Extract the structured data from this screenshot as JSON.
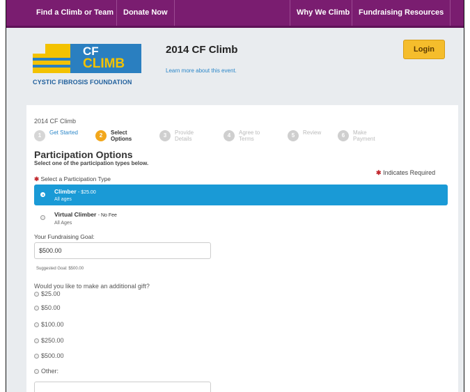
{
  "nav": {
    "items": [
      "Find a Climb or Team",
      "Donate Now",
      "Why We Climb",
      "Fundraising Resources"
    ]
  },
  "header": {
    "logo": {
      "line1": "CF",
      "line2": "CLIMB",
      "org": "CYSTIC FIBROSIS FOUNDATION"
    },
    "event_title": "2014 CF Climb",
    "event_link": "Learn more about this event.",
    "login_label": "Login"
  },
  "progress": {
    "crumb": "2014 CF Climb",
    "steps": [
      {
        "num": "1",
        "label": "Get Started",
        "state": "done"
      },
      {
        "num": "2",
        "label": "Select Options",
        "state": "active"
      },
      {
        "num": "3",
        "label": "Provide Details",
        "state": "upcoming"
      },
      {
        "num": "4",
        "label": "Agree to Terms",
        "state": "upcoming"
      },
      {
        "num": "5",
        "label": "Review",
        "state": "upcoming"
      },
      {
        "num": "6",
        "label": "Make Payment",
        "state": "upcoming"
      }
    ]
  },
  "form": {
    "heading": "Participation Options",
    "subheading": "Select one of the participation types below.",
    "required_note": "Indicates Required",
    "type_label": "Select a Participation Type",
    "options": [
      {
        "title": "Climber",
        "fee": "- $25.00",
        "sub": "All ages",
        "selected": true
      },
      {
        "title": "Virtual Climber",
        "fee": "- No Fee",
        "sub": "All Ages",
        "selected": false
      }
    ],
    "goal_label": "Your Fundraising Goal:",
    "goal_value": "$500.00",
    "goal_hint": "Suggested Goal: $500.00",
    "gift_question": "Would you like to make an additional gift?",
    "gift_options": [
      "$25.00",
      "$50.00",
      "$100.00",
      "$250.00",
      "$500.00",
      "Other:"
    ]
  },
  "colors": {
    "nav_bg": "#7a1d70",
    "selected_bg": "#1a9ad6",
    "login_bg": "#f5bd2c",
    "active_step": "#f2a71c",
    "required_star": "#c1272d"
  }
}
